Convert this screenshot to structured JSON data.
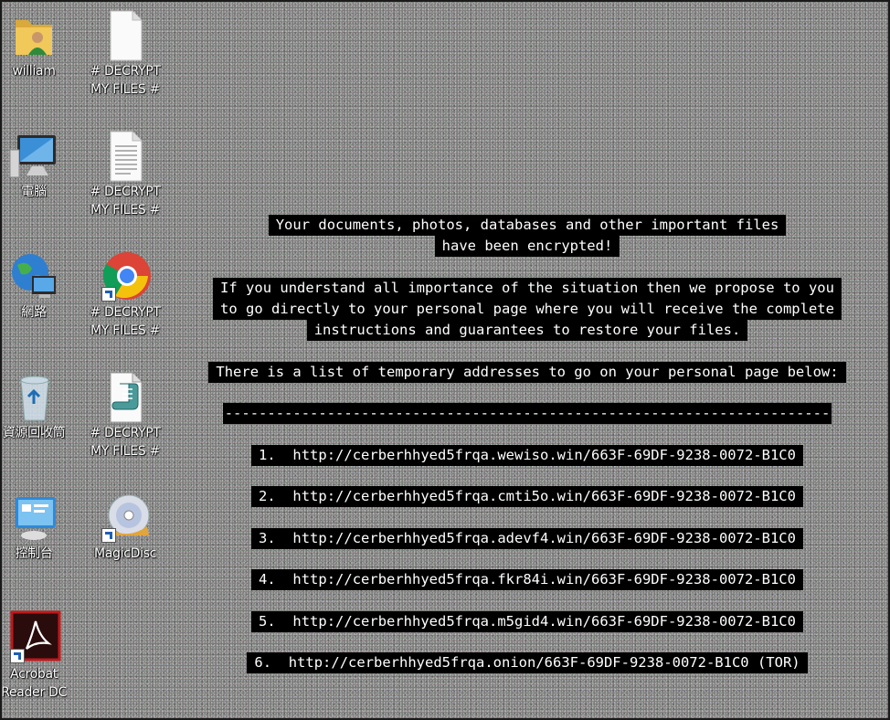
{
  "desktop": {
    "icons": [
      {
        "label": "william"
      },
      {
        "label": "# DECRYPT\nMY FILES #"
      },
      {
        "label": "電腦"
      },
      {
        "label": "# DECRYPT\nMY FILES #"
      },
      {
        "label": "網路"
      },
      {
        "label": "# DECRYPT\nMY FILES #"
      },
      {
        "label": "資源回收筒"
      },
      {
        "label": "# DECRYPT\nMY FILES #"
      },
      {
        "label": "控制台"
      },
      {
        "label": "MagicDisc"
      },
      {
        "label": "Acrobat\nReader DC"
      }
    ]
  },
  "message": {
    "headline_1": "Your documents, photos, databases and other important files",
    "headline_2": "have been encrypted!",
    "para_1": "If you understand all importance of the situation then we propose to you",
    "para_2": "to go directly to your personal page where you will receive the complete",
    "para_3": "instructions and guarantees to restore your files.",
    "list_intro": "There is a list of temporary addresses to go on your personal page below:",
    "separator": "-----------------------------------------------------------------------",
    "addresses": [
      "1.  http://cerberhhyed5frqa.wewiso.win/663F-69DF-9238-0072-B1C0",
      "2.  http://cerberhhyed5frqa.cmti5o.win/663F-69DF-9238-0072-B1C0",
      "3.  http://cerberhhyed5frqa.adevf4.win/663F-69DF-9238-0072-B1C0",
      "4.  http://cerberhhyed5frqa.fkr84i.win/663F-69DF-9238-0072-B1C0",
      "5.  http://cerberhhyed5frqa.m5gid4.win/663F-69DF-9238-0072-B1C0",
      "6.  http://cerberhhyed5frqa.onion/663F-69DF-9238-0072-B1C0 (TOR)"
    ]
  }
}
